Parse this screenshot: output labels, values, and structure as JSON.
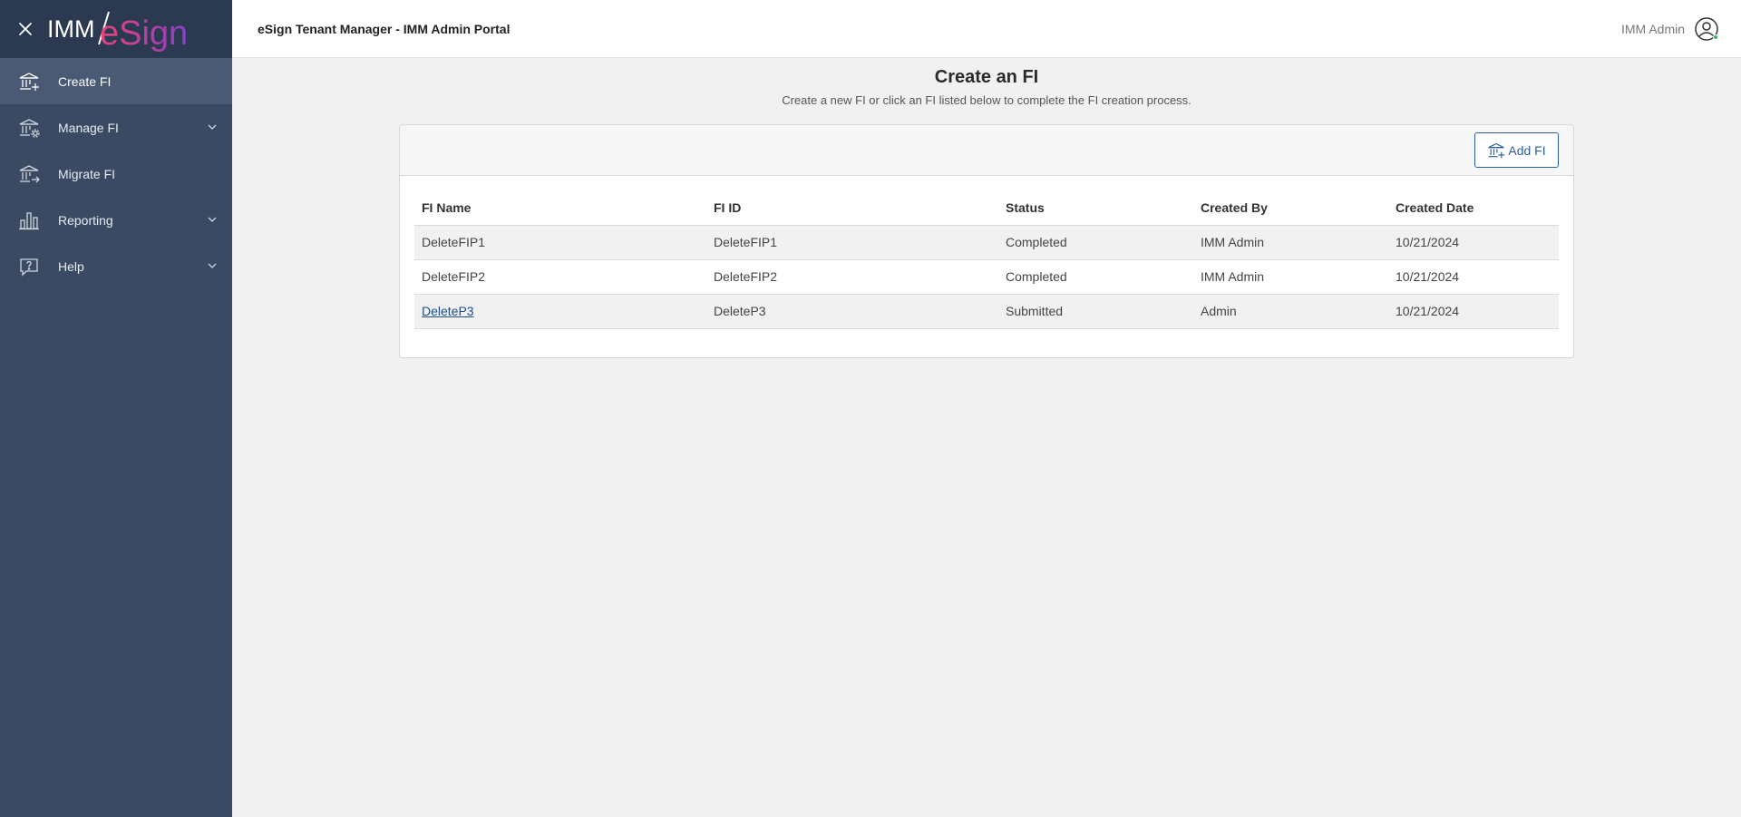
{
  "sidebar": {
    "logo_text": "IMM/eSign",
    "items": [
      {
        "label": "Create FI",
        "icon": "bank-plus-icon"
      },
      {
        "label": "Manage FI",
        "icon": "bank-gear-icon"
      },
      {
        "label": "Migrate FI",
        "icon": "bank-arrow-icon"
      },
      {
        "label": "Reporting",
        "icon": "bar-chart-icon"
      },
      {
        "label": "Help",
        "icon": "help-bubble-icon"
      }
    ]
  },
  "header": {
    "title": "eSign Tenant Manager - IMM Admin Portal",
    "user_name": "IMM Admin"
  },
  "main": {
    "title": "Create an FI",
    "subtitle": "Create a new FI or click an FI listed below to complete the FI creation process.",
    "add_button_label": "Add FI",
    "table": {
      "columns": [
        "FI Name",
        "FI ID",
        "Status",
        "Created By",
        "Created Date"
      ],
      "rows": [
        [
          "DeleteFIP1",
          "DeleteFIP1",
          "Completed",
          "IMM Admin",
          "10/21/2024"
        ],
        [
          "DeleteFIP2",
          "DeleteFIP2",
          "Completed",
          "IMM Admin",
          "10/21/2024"
        ],
        [
          "DeleteP3",
          "DeleteP3",
          "Submitted",
          "Admin",
          "10/21/2024"
        ]
      ]
    }
  },
  "colors": {
    "sidebar_bg": "#3b4a63",
    "sidebar_top_bg": "#2c3a51",
    "accent_blue": "#2b5f9e",
    "logo_pink": "#e8437a",
    "logo_purple": "#8a3fc5",
    "status_green": "#3cb371"
  }
}
